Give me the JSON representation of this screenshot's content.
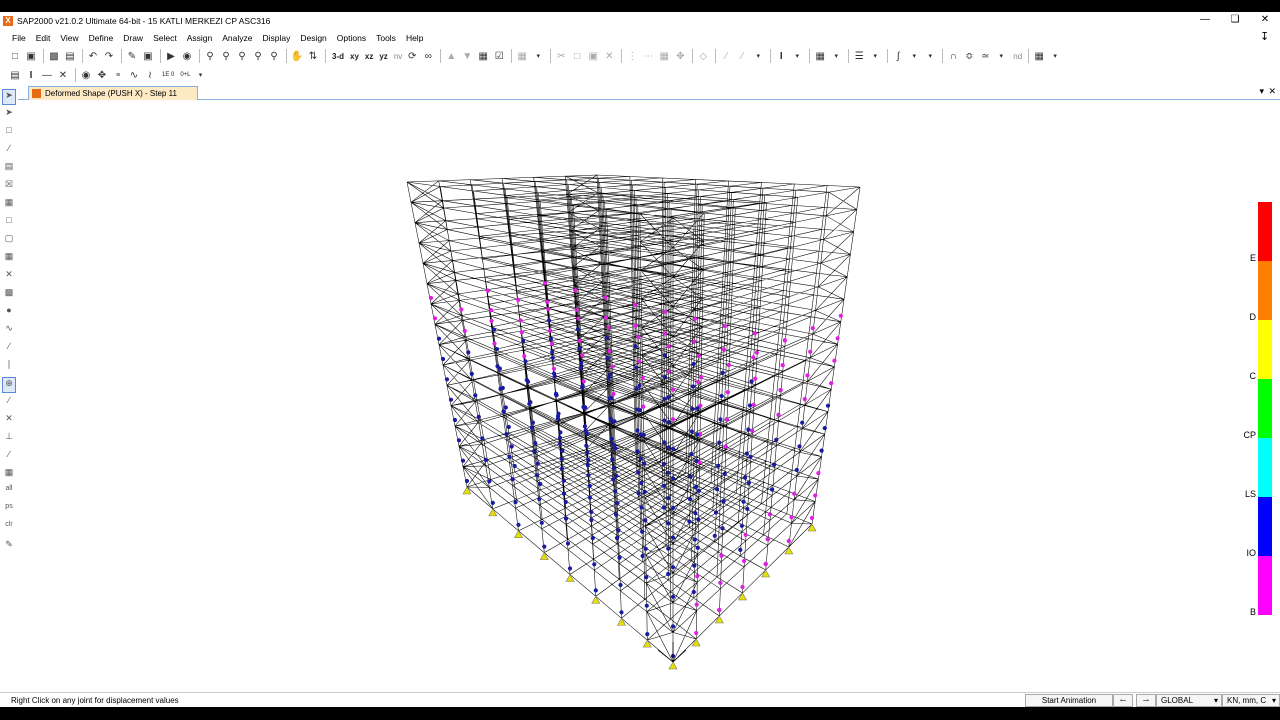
{
  "window": {
    "title": "SAP2000 v21.0.2 Ultimate 64-bit - 15 KATLI MERKEZI CP ASC316"
  },
  "menu": [
    "File",
    "Edit",
    "View",
    "Define",
    "Draw",
    "Select",
    "Assign",
    "Analyze",
    "Display",
    "Design",
    "Options",
    "Tools",
    "Help"
  ],
  "toolbar": {
    "view_3d": "3-d",
    "view_xy": "xy",
    "view_xz": "xz",
    "view_yz": "yz",
    "view_nv": "nv",
    "nd": "nd"
  },
  "toolbar2": {
    "lbl_a": "1E 0",
    "lbl_b": "1.5 E",
    "lbl_c": "0+L",
    "lbl_d": "+E"
  },
  "tab": {
    "label": "Deformed Shape (PUSH X) - Step 11"
  },
  "legend": [
    {
      "label": "E",
      "color": "#ff0000"
    },
    {
      "label": "D",
      "color": "#ff8000"
    },
    {
      "label": "C",
      "color": "#ffff00"
    },
    {
      "label": "CP",
      "color": "#00ff00"
    },
    {
      "label": "LS",
      "color": "#00ffff"
    },
    {
      "label": "IO",
      "color": "#0000ff"
    },
    {
      "label": "B",
      "color": "#ff00ff"
    }
  ],
  "status": {
    "hint": "Right Click on any joint for displacement values",
    "animation_button": "Start Animation",
    "coord_system": "GLOBAL",
    "units": "KN, mm, C"
  },
  "colors": {
    "hinge_io": "#1a1aa0",
    "hinge_b": "#e020e0",
    "support": "#e8e000",
    "frame": "#000000"
  }
}
